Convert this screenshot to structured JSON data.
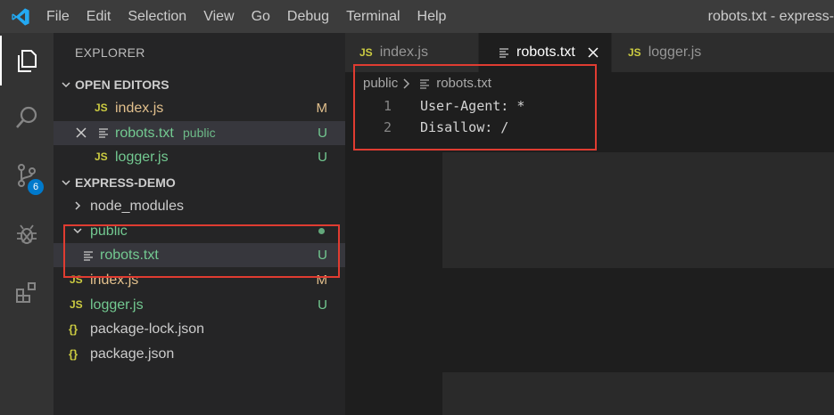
{
  "menu": [
    "File",
    "Edit",
    "Selection",
    "View",
    "Go",
    "Debug",
    "Terminal",
    "Help"
  ],
  "window_title": "robots.txt - express-",
  "activity": {
    "scm_badge": "6"
  },
  "explorer": {
    "title": "EXPLORER",
    "open_editors": {
      "label": "OPEN EDITORS",
      "items": [
        {
          "icon": "JS",
          "name": "index.js",
          "status": "M"
        },
        {
          "name": "robots.txt",
          "folder": "public",
          "status": "U"
        },
        {
          "icon": "JS",
          "name": "logger.js",
          "status": "U"
        }
      ]
    },
    "project": {
      "label": "EXPRESS-DEMO",
      "items": [
        {
          "name": "node_modules"
        },
        {
          "name": "public"
        },
        {
          "name": "robots.txt",
          "status": "U"
        },
        {
          "icon": "JS",
          "name": "index.js",
          "status": "M"
        },
        {
          "icon": "JS",
          "name": "logger.js",
          "status": "U"
        },
        {
          "icon": "{}",
          "name": "package-lock.json"
        },
        {
          "icon": "{}",
          "name": "package.json"
        }
      ]
    }
  },
  "tabs": [
    {
      "icon": "JS",
      "label": "index.js"
    },
    {
      "label": "robots.txt"
    },
    {
      "icon": "JS",
      "label": "logger.js"
    }
  ],
  "breadcrumb": {
    "folder": "public",
    "file": "robots.txt"
  },
  "code_lines": [
    {
      "num": "1",
      "text": "User-Agent: *"
    },
    {
      "num": "2",
      "text": "Disallow: /"
    }
  ],
  "colors": {
    "highlight_box": "#e03c31",
    "accent": "#007acc",
    "untracked": "#73c991",
    "modified": "#e2c08d"
  }
}
